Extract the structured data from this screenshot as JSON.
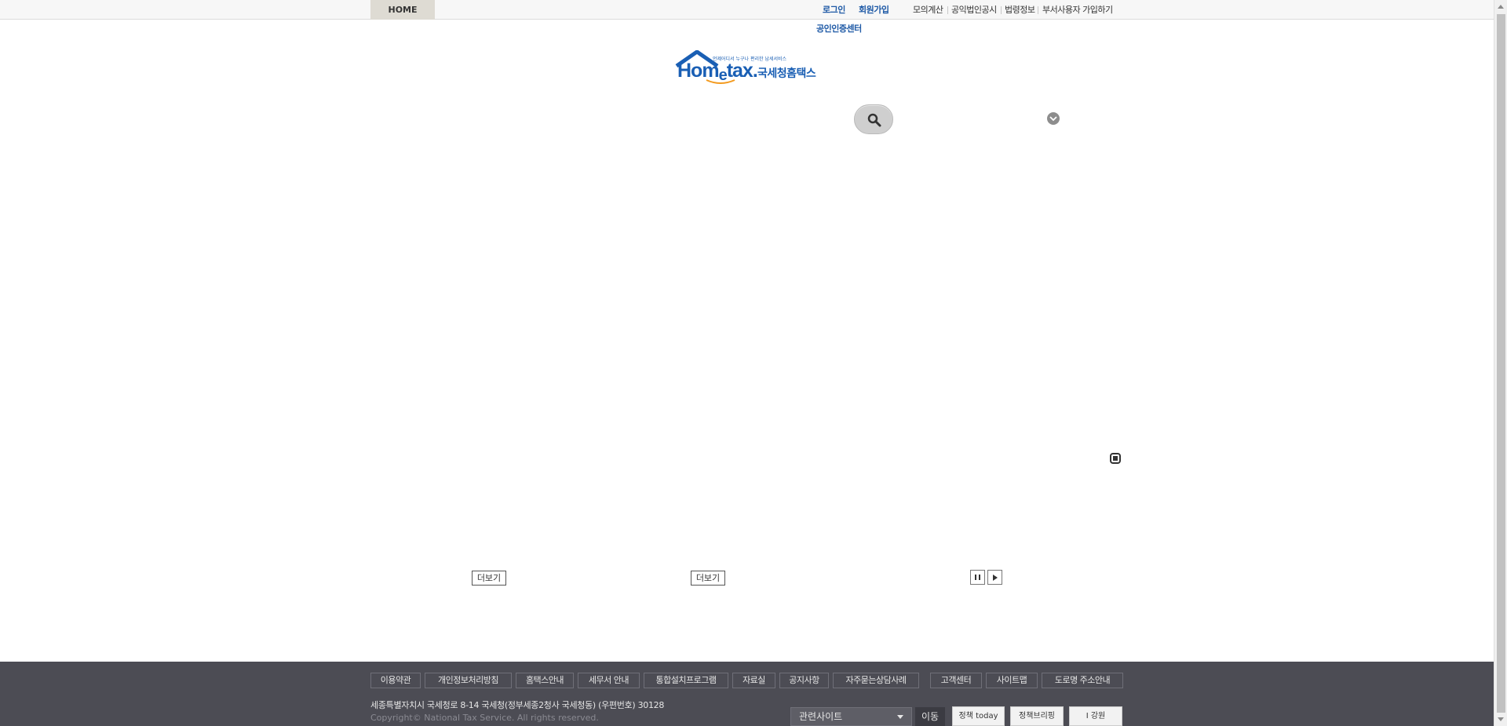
{
  "topbar": {
    "home_tab": "HOME",
    "links": {
      "login": "로그인",
      "signup": "회원가입",
      "mock_calc": "모의계산",
      "public_corp": "공익법인공시",
      "law_info": "법령정보",
      "dept_user": "부서사용자 가입하기"
    },
    "cert_center": "공인인증센터"
  },
  "logo": {
    "small_text": "언제어디서 누구나 편리한 납세서비스",
    "brand_main": "Hom",
    "brand_e": "e",
    "brand_tail": "tax.",
    "brand_korean": "국세청홈택스"
  },
  "search": {
    "button_icon": "search-icon"
  },
  "main": {
    "more_label_1": "더보기",
    "more_label_2": "더보기"
  },
  "footer": {
    "links": [
      "이용약관",
      "개인정보처리방침",
      "홈택스안내",
      "세무서 안내",
      "통합설치프로그램",
      "자료실",
      "공지사항",
      "자주묻는상담사례",
      "고객센터",
      "사이트맵",
      "도로명 주소안내"
    ],
    "address": "세종특별자치시 국세청로 8-14 국세청(정부세종2청사 국세청동) (우편번호) 30128",
    "copyright": "Copyright© National Tax Service. All rights reserved.",
    "related_site": "관련사이트",
    "go_label": "이동",
    "banners": [
      "정책 today",
      "정책브리핑",
      "I 강원"
    ]
  },
  "colors": {
    "brand_blue": "#1f5aa6",
    "footer_bg": "#4c4c54",
    "home_tab_bg": "#dedbd3"
  }
}
